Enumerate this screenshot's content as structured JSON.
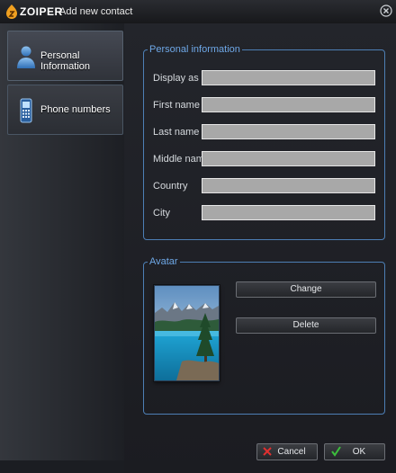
{
  "window": {
    "brand": "ZOIPER",
    "title": "Add new contact"
  },
  "sidebar": {
    "items": [
      {
        "label": "Personal Information",
        "icon": "person-icon",
        "active": true
      },
      {
        "label": "Phone numbers",
        "icon": "phone-icon",
        "active": false
      }
    ]
  },
  "personal": {
    "legend": "Personal information",
    "fields": [
      {
        "label": "Display as",
        "value": ""
      },
      {
        "label": "First name",
        "value": ""
      },
      {
        "label": "Last name",
        "value": ""
      },
      {
        "label": "Middle name",
        "value": ""
      },
      {
        "label": "Country",
        "value": ""
      },
      {
        "label": "City",
        "value": ""
      }
    ]
  },
  "avatar": {
    "legend": "Avatar",
    "change_label": "Change",
    "delete_label": "Delete"
  },
  "footer": {
    "cancel_label": "Cancel",
    "ok_label": "OK"
  },
  "colors": {
    "accent": "#4d7fb5",
    "legend_text": "#6ea7e6",
    "input_bg": "#a8a8a8",
    "cancel_icon": "#e03030",
    "ok_icon": "#3cbf3c"
  }
}
